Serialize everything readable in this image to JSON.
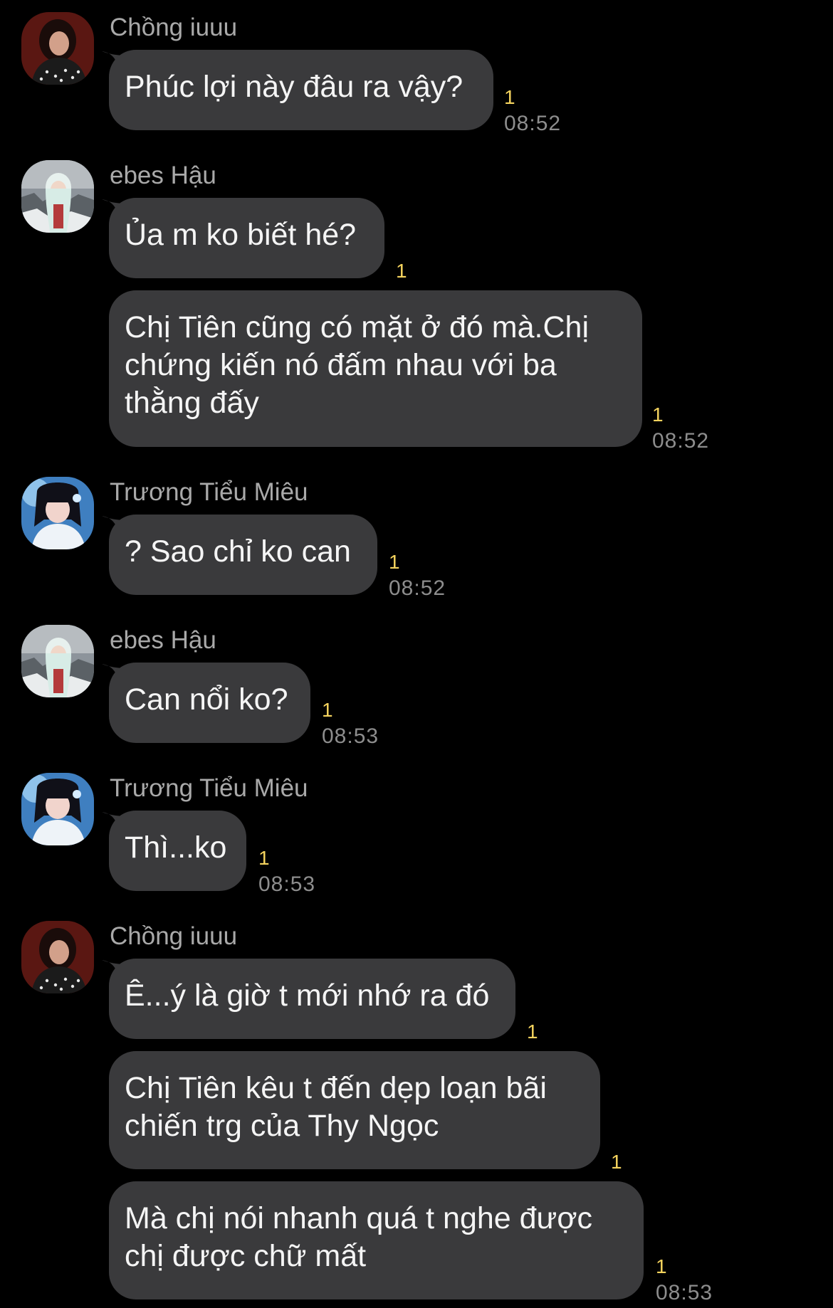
{
  "accent_unread_color": "#f4d35e",
  "bubble_color": "#3a3a3c",
  "messages": [
    {
      "sender": "Chồng iuuu",
      "text": [
        "Phúc lợi này đâu ra vậy?"
      ],
      "unread": "1",
      "time": "08:52"
    },
    {
      "sender": "ebes Hậu",
      "text": [
        "Ủa m ko biết hé?"
      ],
      "unread": "1",
      "time": ""
    },
    {
      "sender": "",
      "text": [
        "Chị Tiên cũng có mặt ở đó mà.Chị",
        "chứng kiến nó đấm nhau với ba",
        "thằng đấy"
      ],
      "unread": "1",
      "time": "08:52"
    },
    {
      "sender": "Trương Tiểu Miêu",
      "text": [
        "? Sao chỉ ko can"
      ],
      "unread": "1",
      "time": "08:52"
    },
    {
      "sender": "ebes Hậu",
      "text": [
        "Can nổi ko?"
      ],
      "unread": "1",
      "time": "08:53"
    },
    {
      "sender": "Trương Tiểu Miêu",
      "text": [
        "Thì...ko"
      ],
      "unread": "1",
      "time": "08:53"
    },
    {
      "sender": "Chồng iuuu",
      "text": [
        "Ê...ý là giờ t mới nhớ ra đó"
      ],
      "unread": "1",
      "time": ""
    },
    {
      "sender": "",
      "text": [
        "Chị Tiên kêu t đến dẹp loạn bãi",
        "chiến trg của Thy Ngọc"
      ],
      "unread": "1",
      "time": ""
    },
    {
      "sender": "",
      "text": [
        "Mà chị nói nhanh quá t nghe được",
        "chị được chữ mất"
      ],
      "unread": "1",
      "time": "08:53"
    }
  ]
}
